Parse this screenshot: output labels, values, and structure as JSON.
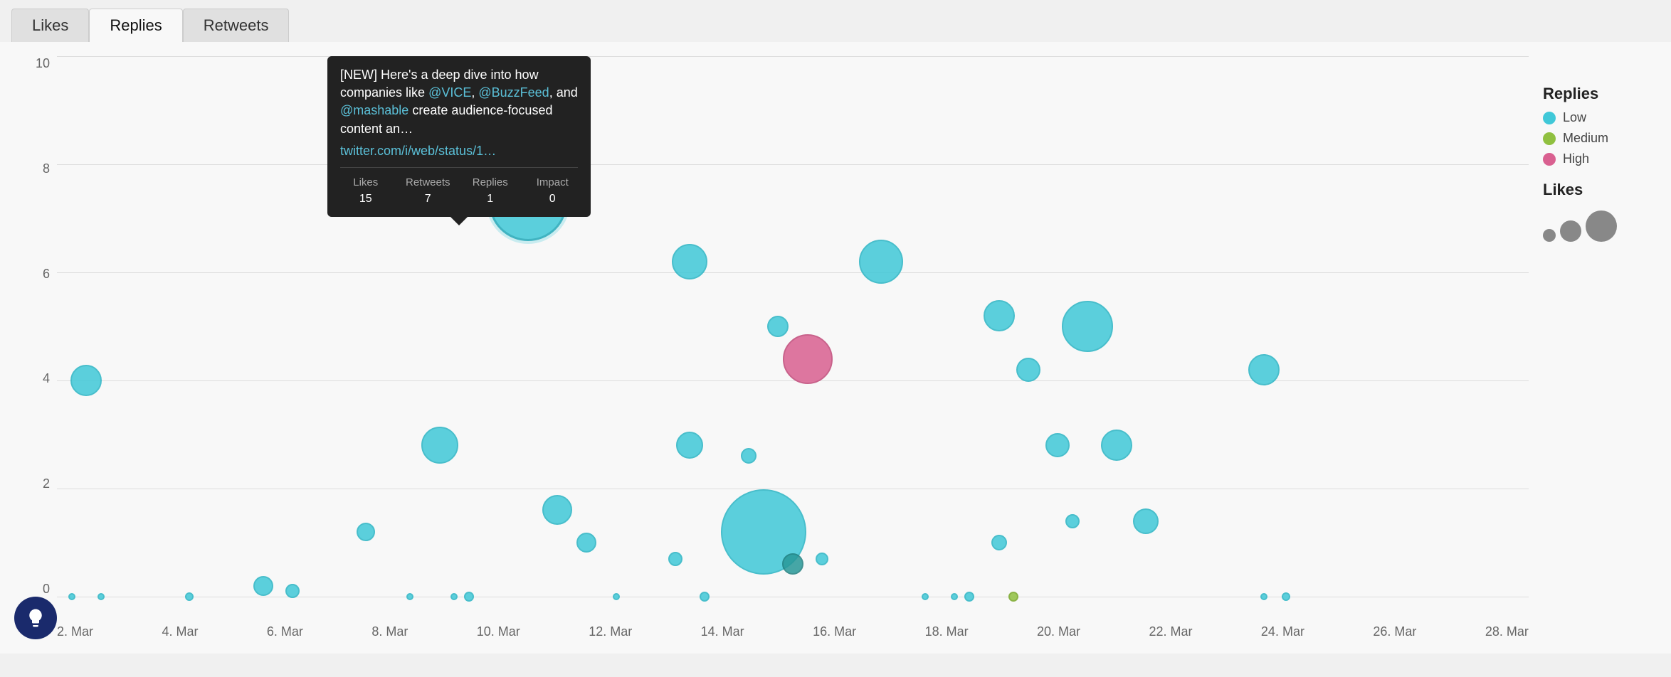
{
  "tabs": [
    {
      "label": "Likes",
      "active": false
    },
    {
      "label": "Replies",
      "active": true
    },
    {
      "label": "Retweets",
      "active": false
    }
  ],
  "chart": {
    "yAxis": {
      "labels": [
        "10",
        "8",
        "6",
        "4",
        "2",
        "0"
      ]
    },
    "xAxis": {
      "labels": [
        "2. Mar",
        "4. Mar",
        "6. Mar",
        "8. Mar",
        "10. Mar",
        "12. Mar",
        "14. Mar",
        "16. Mar",
        "18. Mar",
        "20. Mar",
        "22. Mar",
        "24. Mar",
        "26. Mar",
        "28. Mar"
      ]
    }
  },
  "tooltip": {
    "text": "[NEW] Here's a deep dive into how companies like ",
    "mention1": "@VICE",
    "text2": ", ",
    "mention2": "@BuzzFeed",
    "text3": ", and ",
    "mention3": "@mashable",
    "text4": " create audience-focused content an…",
    "link": "twitter.com/i/web/status/1…",
    "stats": [
      {
        "label": "Likes",
        "value": "15"
      },
      {
        "label": "Retweets",
        "value": "7"
      },
      {
        "label": "Replies",
        "value": "1"
      },
      {
        "label": "Impact",
        "value": "0"
      }
    ]
  },
  "legend": {
    "replies_title": "Replies",
    "items": [
      {
        "color": "cyan",
        "label": "Low"
      },
      {
        "color": "green",
        "label": "Medium"
      },
      {
        "color": "pink",
        "label": "High"
      }
    ],
    "likes_title": "Likes"
  }
}
